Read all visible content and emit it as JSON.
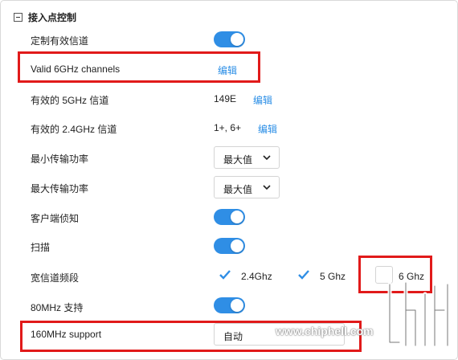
{
  "section": {
    "title": "接入点控制"
  },
  "rows": {
    "custom_channels": {
      "label": "定制有效信道",
      "enabled": true
    },
    "valid_6ghz": {
      "label": "Valid 6GHz channels",
      "edit": "编辑"
    },
    "valid_5ghz": {
      "label": "有效的 5GHz 信道",
      "value": "149E",
      "edit": "编辑"
    },
    "valid_24ghz": {
      "label": "有效的 2.4GHz 信道",
      "value": "1+, 6+",
      "edit": "编辑"
    },
    "min_power": {
      "label": "最小传输功率",
      "selected": "最大值"
    },
    "max_power": {
      "label": "最大传输功率",
      "selected": "最大值"
    },
    "client_sniffing": {
      "label": "客户端侦知",
      "enabled": true
    },
    "scan": {
      "label": "扫描",
      "enabled": true
    },
    "wide_channel": {
      "label": "宽信道频段",
      "options": [
        {
          "label": "2.4Ghz",
          "checked": true
        },
        {
          "label": "5 Ghz",
          "checked": true
        },
        {
          "label": "6 Ghz",
          "checked": false
        }
      ]
    },
    "support_80mhz": {
      "label": "80MHz 支持",
      "enabled": true
    },
    "support_160mhz": {
      "label": "160MHz support",
      "selected": "自动"
    }
  },
  "watermark": {
    "text": "www.chiphell.com"
  },
  "colors": {
    "accent": "#2f8ee5",
    "link": "#2a8ee6",
    "highlight": "#e11a1a"
  }
}
